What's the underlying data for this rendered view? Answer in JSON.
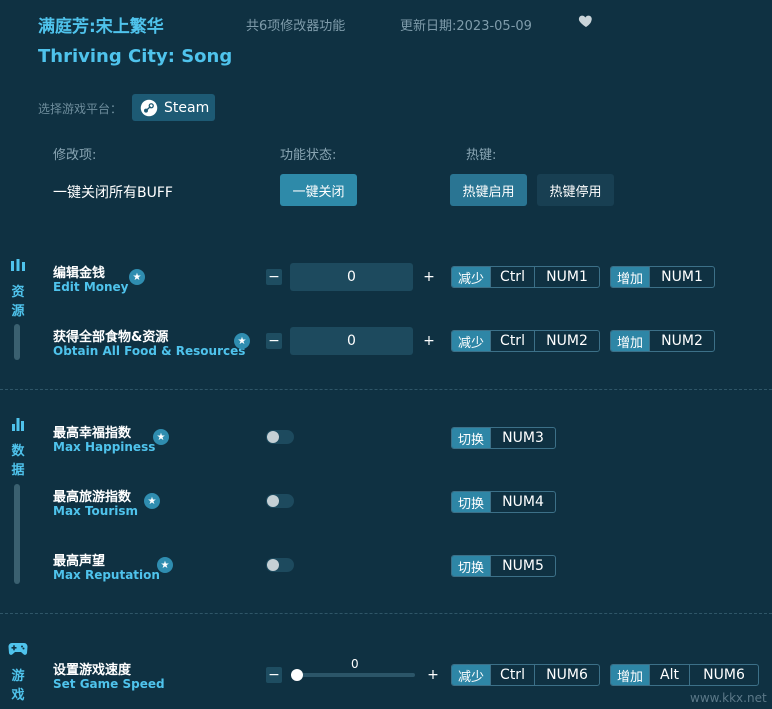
{
  "header": {
    "title_cn": "满庭芳:宋上繁华",
    "feature_count": "共6项修改器功能",
    "update_date": "更新日期:2023-05-09",
    "title_en": "Thriving City: Song"
  },
  "platform": {
    "label": "选择游戏平台：",
    "steam_label": "Steam"
  },
  "columns": {
    "mod": "修改项:",
    "status": "功能状态:",
    "hotkey": "热键:"
  },
  "global": {
    "buff_label": "一键关闭所有BUFF",
    "close_all": "一键关闭",
    "hotkey_on": "热键启用",
    "hotkey_off": "热键停用"
  },
  "sections": {
    "resources": "资\n源",
    "data": "数\n据",
    "game": "游\n戏"
  },
  "items": {
    "edit_money": {
      "cn": "编辑金钱",
      "en": "Edit Money",
      "value": "0",
      "dec_tag": "减少",
      "dec_keys": [
        "Ctrl",
        "NUM1"
      ],
      "inc_tag": "增加",
      "inc_keys": [
        "NUM1"
      ]
    },
    "food": {
      "cn": "获得全部食物&资源",
      "en": "Obtain All Food & Resources",
      "value": "0",
      "dec_tag": "减少",
      "dec_keys": [
        "Ctrl",
        "NUM2"
      ],
      "inc_tag": "增加",
      "inc_keys": [
        "NUM2"
      ]
    },
    "happiness": {
      "cn": "最高幸福指数",
      "en": "Max Happiness",
      "tag": "切换",
      "key": "NUM3"
    },
    "tourism": {
      "cn": "最高旅游指数",
      "en": "Max Tourism",
      "tag": "切换",
      "key": "NUM4"
    },
    "reputation": {
      "cn": "最高声望",
      "en": "Max Reputation",
      "tag": "切换",
      "key": "NUM5"
    },
    "speed": {
      "cn": "设置游戏速度",
      "en": "Set Game Speed",
      "value": "0",
      "dec_tag": "减少",
      "dec_keys": [
        "Ctrl",
        "NUM6"
      ],
      "inc_tag": "增加",
      "inc_keys": [
        "Alt",
        "NUM6"
      ]
    }
  },
  "symbols": {
    "minus": "−",
    "plus": "+",
    "star": "★"
  },
  "watermark": "www.kkx.net",
  "colors": {
    "background": "#0f3142",
    "accent": "#4fc3ec",
    "button": "#2e8aa9"
  }
}
